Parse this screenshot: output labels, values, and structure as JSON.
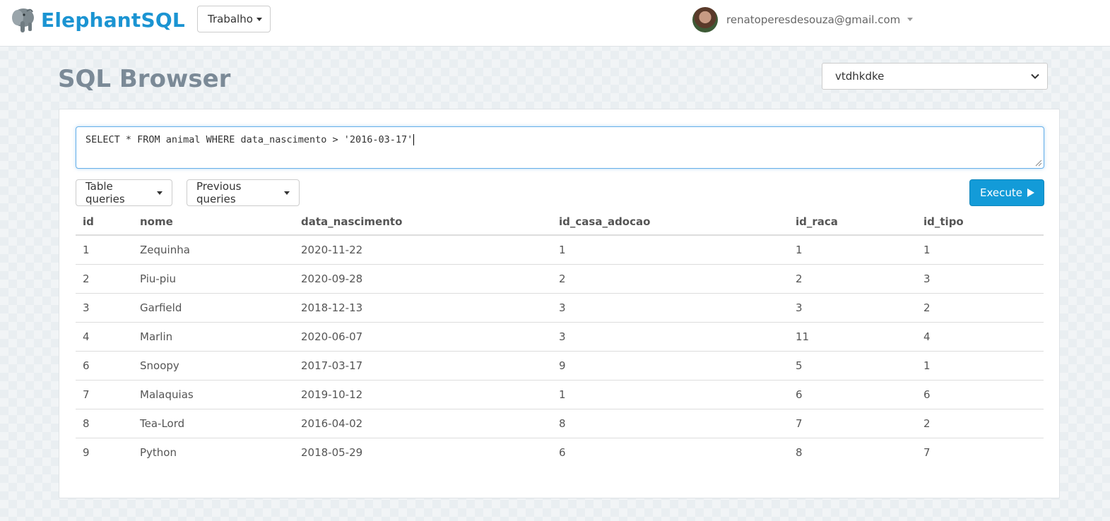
{
  "brand": {
    "name": "ElephantSQL"
  },
  "navbar": {
    "team_selector": "Trabalho",
    "user_email": "renatoperesdesouza@gmail.com"
  },
  "page": {
    "title": "SQL Browser",
    "database_selected": "vtdhkdke"
  },
  "editor": {
    "query": "SELECT * FROM animal WHERE data_nascimento > '2016-03-17'"
  },
  "buttons": {
    "table_queries": "Table queries",
    "previous_queries": "Previous queries",
    "execute": "Execute"
  },
  "results": {
    "columns": [
      "id",
      "nome",
      "data_nascimento",
      "id_casa_adocao",
      "id_raca",
      "id_tipo"
    ],
    "rows": [
      [
        "1",
        "Zequinha",
        "2020-11-22",
        "1",
        "1",
        "1"
      ],
      [
        "2",
        "Piu-piu",
        "2020-09-28",
        "2",
        "2",
        "3"
      ],
      [
        "3",
        "Garfield",
        "2018-12-13",
        "3",
        "3",
        "2"
      ],
      [
        "4",
        "Marlin",
        "2020-06-07",
        "3",
        "11",
        "4"
      ],
      [
        "6",
        "Snoopy",
        "2017-03-17",
        "9",
        "5",
        "1"
      ],
      [
        "7",
        "Malaquias",
        "2019-10-12",
        "1",
        "6",
        "6"
      ],
      [
        "8",
        "Tea-Lord",
        "2016-04-02",
        "8",
        "7",
        "2"
      ],
      [
        "9",
        "Python",
        "2018-05-29",
        "6",
        "8",
        "7"
      ]
    ]
  },
  "colors": {
    "brand": "#1b94d2",
    "execute_button": "#139bd8"
  }
}
